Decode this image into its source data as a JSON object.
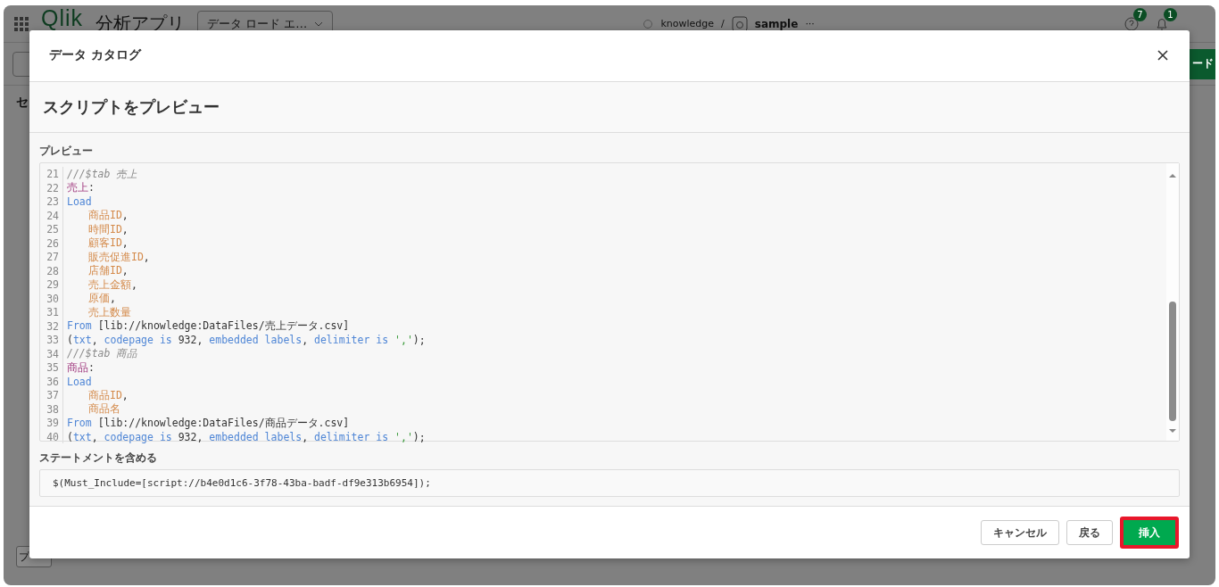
{
  "app_header": {
    "logo": "Qlik",
    "app_name": "分析アプリ",
    "mode_dropdown": "データ ロード エ…",
    "breadcrumb": {
      "space": "knowledge",
      "separator": "/",
      "app": "sample",
      "more": "···"
    },
    "help_badge": "7",
    "notification_badge": "1"
  },
  "toolbar": {
    "primary_button": "ード"
  },
  "side_panel": {
    "heading": "セ",
    "bottom_button": "プ"
  },
  "dialog": {
    "title": "データ カタログ",
    "subtitle": "スクリプトをプレビュー",
    "preview_label": "プレビュー",
    "code_lines": [
      {
        "number": "21",
        "indent": false,
        "tokens": [
          {
            "kind": "comment",
            "text": "///$tab 売上"
          }
        ]
      },
      {
        "number": "22",
        "indent": false,
        "tokens": [
          {
            "kind": "label",
            "text": "売上"
          },
          {
            "kind": "plain",
            "text": ":"
          }
        ]
      },
      {
        "number": "23",
        "indent": false,
        "tokens": [
          {
            "kind": "keyword",
            "text": "Load"
          }
        ]
      },
      {
        "number": "24",
        "indent": true,
        "tokens": [
          {
            "kind": "field",
            "text": "商品ID"
          },
          {
            "kind": "plain",
            "text": ","
          }
        ]
      },
      {
        "number": "25",
        "indent": true,
        "tokens": [
          {
            "kind": "field",
            "text": "時間ID"
          },
          {
            "kind": "plain",
            "text": ","
          }
        ]
      },
      {
        "number": "26",
        "indent": true,
        "tokens": [
          {
            "kind": "field",
            "text": "顧客ID"
          },
          {
            "kind": "plain",
            "text": ","
          }
        ]
      },
      {
        "number": "27",
        "indent": true,
        "tokens": [
          {
            "kind": "field",
            "text": "販売促進ID"
          },
          {
            "kind": "plain",
            "text": ","
          }
        ]
      },
      {
        "number": "28",
        "indent": true,
        "tokens": [
          {
            "kind": "field",
            "text": "店舗ID"
          },
          {
            "kind": "plain",
            "text": ","
          }
        ]
      },
      {
        "number": "29",
        "indent": true,
        "tokens": [
          {
            "kind": "field",
            "text": "売上金額"
          },
          {
            "kind": "plain",
            "text": ","
          }
        ]
      },
      {
        "number": "30",
        "indent": true,
        "tokens": [
          {
            "kind": "field",
            "text": "原価"
          },
          {
            "kind": "plain",
            "text": ","
          }
        ]
      },
      {
        "number": "31",
        "indent": true,
        "tokens": [
          {
            "kind": "field",
            "text": "売上数量"
          }
        ]
      },
      {
        "number": "32",
        "indent": false,
        "tokens": [
          {
            "kind": "keyword",
            "text": "From"
          },
          {
            "kind": "plain",
            "text": " [lib://knowledge:DataFiles/売上データ.csv]"
          }
        ]
      },
      {
        "number": "33",
        "indent": false,
        "tokens": [
          {
            "kind": "plain",
            "text": "("
          },
          {
            "kind": "keyword",
            "text": "txt"
          },
          {
            "kind": "plain",
            "text": ", "
          },
          {
            "kind": "keyword",
            "text": "codepage is"
          },
          {
            "kind": "plain",
            "text": " 932, "
          },
          {
            "kind": "keyword",
            "text": "embedded labels"
          },
          {
            "kind": "plain",
            "text": ", "
          },
          {
            "kind": "keyword",
            "text": "delimiter is"
          },
          {
            "kind": "string",
            "text": " ','"
          },
          {
            "kind": "plain",
            "text": ");"
          }
        ]
      },
      {
        "number": "34",
        "indent": false,
        "tokens": [
          {
            "kind": "comment",
            "text": "///$tab 商品"
          }
        ]
      },
      {
        "number": "35",
        "indent": false,
        "tokens": [
          {
            "kind": "label",
            "text": "商品"
          },
          {
            "kind": "plain",
            "text": ":"
          }
        ]
      },
      {
        "number": "36",
        "indent": false,
        "tokens": [
          {
            "kind": "keyword",
            "text": "Load"
          }
        ]
      },
      {
        "number": "37",
        "indent": true,
        "tokens": [
          {
            "kind": "field",
            "text": "商品ID"
          },
          {
            "kind": "plain",
            "text": ","
          }
        ]
      },
      {
        "number": "38",
        "indent": true,
        "tokens": [
          {
            "kind": "field",
            "text": "商品名"
          }
        ]
      },
      {
        "number": "39",
        "indent": false,
        "tokens": [
          {
            "kind": "keyword",
            "text": "From"
          },
          {
            "kind": "plain",
            "text": " [lib://knowledge:DataFiles/商品データ.csv]"
          }
        ]
      },
      {
        "number": "40",
        "indent": false,
        "tokens": [
          {
            "kind": "plain",
            "text": "("
          },
          {
            "kind": "keyword",
            "text": "txt"
          },
          {
            "kind": "plain",
            "text": ", "
          },
          {
            "kind": "keyword",
            "text": "codepage is"
          },
          {
            "kind": "plain",
            "text": " 932, "
          },
          {
            "kind": "keyword",
            "text": "embedded labels"
          },
          {
            "kind": "plain",
            "text": ", "
          },
          {
            "kind": "keyword",
            "text": "delimiter is"
          },
          {
            "kind": "string",
            "text": " ','"
          },
          {
            "kind": "plain",
            "text": ");"
          }
        ]
      }
    ],
    "statement_label": "ステートメントを含める",
    "statement": "$(Must_Include=[script://b4e0d1c6-3f78-43ba-badf-df9e313b6954]);",
    "buttons": [
      {
        "label": "キャンセル",
        "kind": "secondary",
        "highlighted": false
      },
      {
        "label": "戻る",
        "kind": "secondary",
        "highlighted": false
      },
      {
        "label": "挿入",
        "kind": "primary",
        "highlighted": true
      }
    ]
  }
}
